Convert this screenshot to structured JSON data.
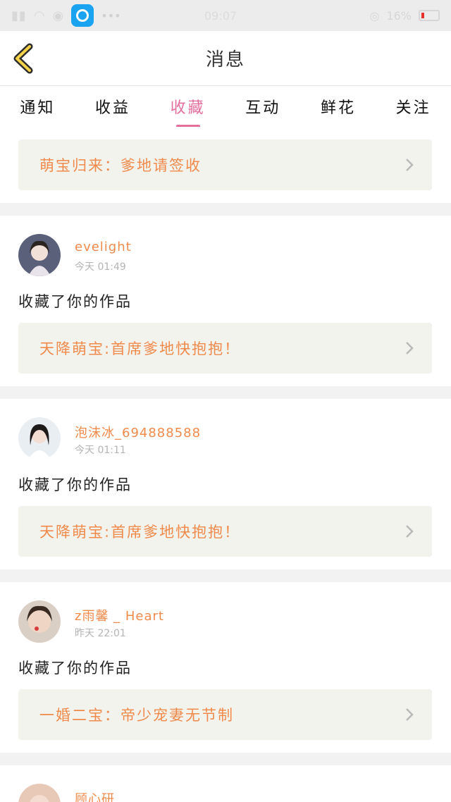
{
  "status_bar": {
    "time": "09:07",
    "battery": "16%",
    "app_icon": "circle-app-icon",
    "colors": {
      "app": "#1aa3f0",
      "battery_low": "#e8302f"
    }
  },
  "header": {
    "title": "消息",
    "back_icon": "chevron-left-icon"
  },
  "tabs": [
    {
      "label": "通知",
      "active": false
    },
    {
      "label": "收益",
      "active": false
    },
    {
      "label": "收藏",
      "active": true
    },
    {
      "label": "互动",
      "active": false
    },
    {
      "label": "鲜花",
      "active": false
    },
    {
      "label": "关注",
      "active": false
    }
  ],
  "banner": {
    "text": "萌宝归来：爹地请签收"
  },
  "messages": [
    {
      "user": "evelight",
      "time": "今天 01:49",
      "action": "收藏了你的作品",
      "work": "天降萌宝:首席爹地快抱抱！"
    },
    {
      "user": "泡沫冰_694888588",
      "time": "今天 01:11",
      "action": "收藏了你的作品",
      "work": "天降萌宝:首席爹地快抱抱！"
    },
    {
      "user": "z雨馨 _ Heart",
      "time": "昨天 22:01",
      "action": "收藏了你的作品",
      "work": "一婚二宝：帝少宠妻无节制"
    },
    {
      "user": "顾心研"
    }
  ],
  "colors": {
    "accent_pink": "#e46f9d",
    "link_orange": "#f08a4b",
    "card_bg": "#f3f3ee"
  }
}
